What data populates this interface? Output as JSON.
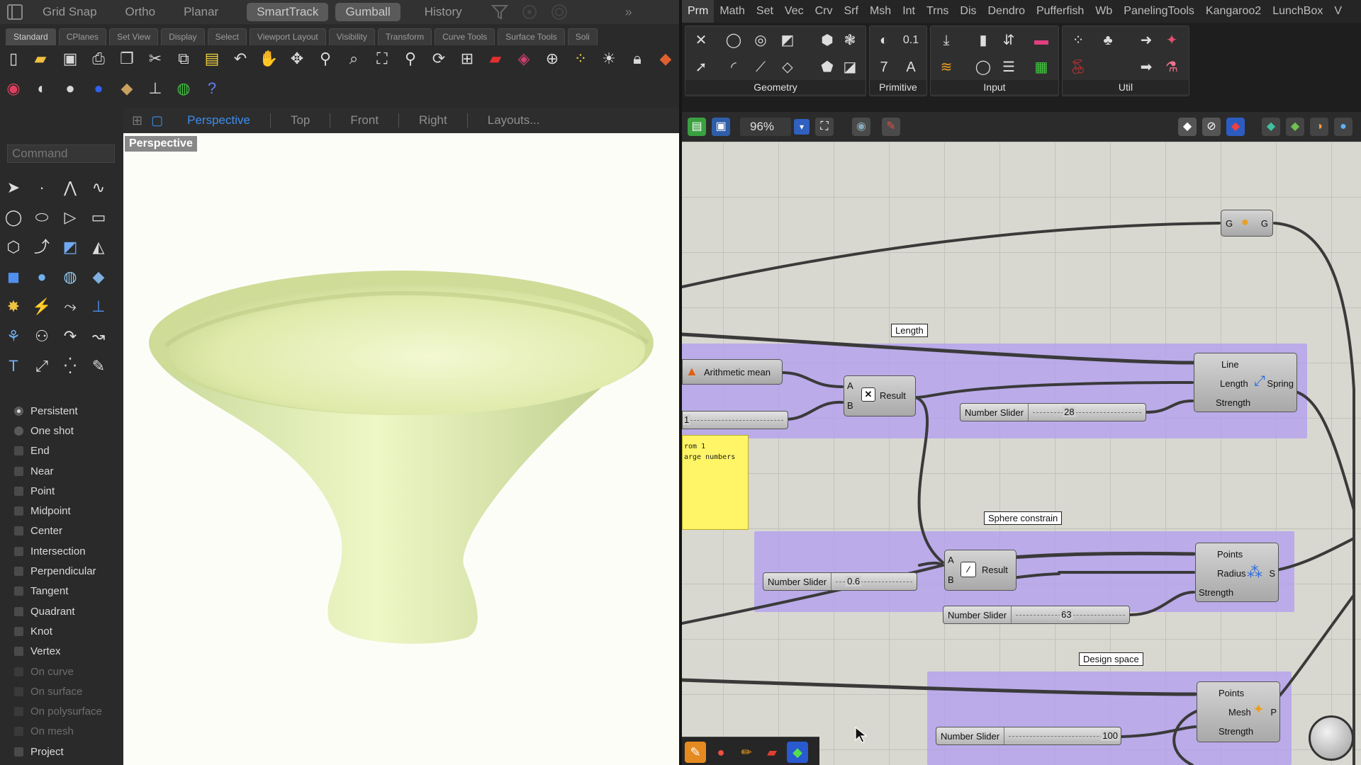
{
  "rhino": {
    "status_items": [
      "Grid Snap",
      "Ortho",
      "Planar",
      "SmartTrack",
      "Gumball",
      "History"
    ],
    "toolbar_tabs": [
      "Standard",
      "CPlanes",
      "Set View",
      "Display",
      "Select",
      "Viewport Layout",
      "Visibility",
      "Transform",
      "Curve Tools",
      "Surface Tools",
      "Soli"
    ],
    "viewport_tabs": [
      "Perspective",
      "Top",
      "Front",
      "Right",
      "Layouts..."
    ],
    "viewport_label": "Perspective",
    "command_placeholder": "Command",
    "osnap_modes": [
      "Persistent",
      "One shot"
    ],
    "osnap_items": [
      "End",
      "Near",
      "Point",
      "Midpoint",
      "Center",
      "Intersection",
      "Perpendicular",
      "Tangent",
      "Quadrant",
      "Knot",
      "Vertex"
    ],
    "osnap_disabled": [
      "On curve",
      "On surface",
      "On polysurface",
      "On mesh"
    ],
    "osnap_last": "Project"
  },
  "gh": {
    "menu": [
      "Prm",
      "Math",
      "Set",
      "Vec",
      "Crv",
      "Srf",
      "Msh",
      "Int",
      "Trns",
      "Dis",
      "Dendro",
      "Pufferfish",
      "Wb",
      "PanelingTools",
      "Kangaroo2",
      "LunchBox",
      "V"
    ],
    "ribbon_groups": [
      "Geometry",
      "Primitive",
      "Input",
      "Util"
    ],
    "zoom": "96%",
    "groups": {
      "length": "Length",
      "sphere": "Sphere constrain",
      "design": "Design space"
    },
    "comp_arith": "Arithmetic mean",
    "comp_mult": {
      "a": "A",
      "b": "B",
      "out": "Result"
    },
    "comp_div": {
      "a": "A",
      "b": "B",
      "out": "Result"
    },
    "comp_spring": {
      "in1": "Line",
      "in2": "Length",
      "in3": "Strength",
      "out": "Spring"
    },
    "comp_sphere": {
      "in1": "Points",
      "in2": "Radius",
      "in3": "Strength",
      "out": "S"
    },
    "comp_onmesh": {
      "in1": "Points",
      "in2": "Mesh",
      "in3": "Strength",
      "out": "P"
    },
    "comp_gate": {
      "in": "G",
      "out": "G"
    },
    "slider_label": "Number Slider",
    "slider_values": {
      "s1": "1",
      "s2": "28",
      "s3": "0.6",
      "s4": "63",
      "s5": "100"
    },
    "note_text": "rom 1\narge numbers"
  }
}
